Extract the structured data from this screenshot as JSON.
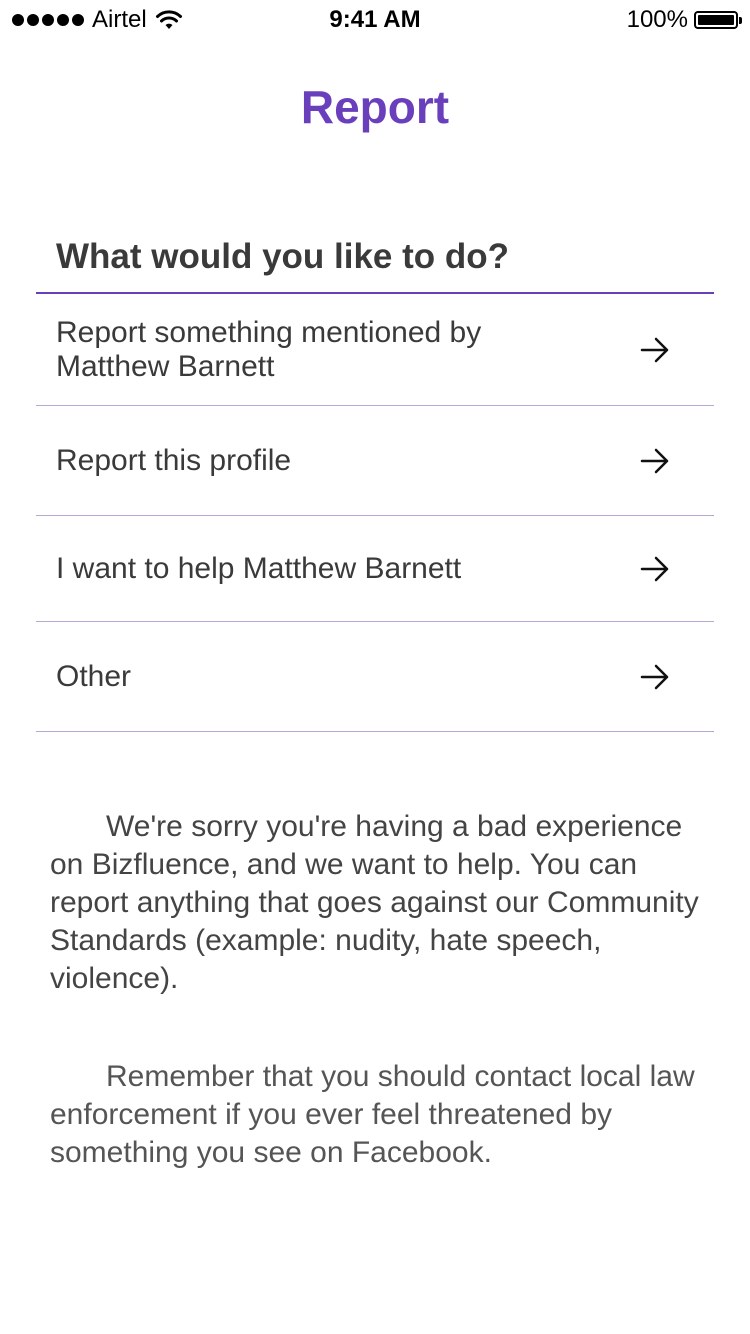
{
  "status_bar": {
    "carrier": "Airtel",
    "time": "9:41 AM",
    "battery_text": "100%",
    "battery_level": 1.0
  },
  "title": "Report",
  "prompt": "What would you like to do?",
  "options": [
    {
      "label": "Report something mentioned by Matthew Barnett",
      "icon": "arrow-right-icon"
    },
    {
      "label": "Report this profile",
      "icon": "arrow-right-icon"
    },
    {
      "label": "I want to help Matthew Barnett",
      "icon": "arrow-right-icon"
    },
    {
      "label": "Other",
      "icon": "arrow-right-icon"
    }
  ],
  "info": {
    "paragraph_1": "We're sorry you're having a bad experience on Bizfluence, and we want to help. You can report anything that goes against our Community Standards (example: nudity, hate speech, violence).",
    "paragraph_2": "Remember that you should contact local law enforcement if you ever feel threatened by something you see on Facebook."
  },
  "colors": {
    "accent": "#6a3fbc",
    "divider": "#b7a6d8",
    "text": "#3a3a3a"
  }
}
